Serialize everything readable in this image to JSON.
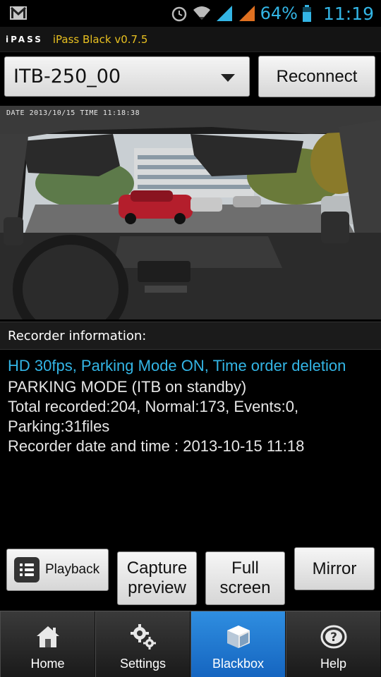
{
  "status_bar": {
    "battery_percent": "64%",
    "time": "11:19",
    "icons": [
      "gmail-icon",
      "alarm-icon",
      "wifi-icon",
      "signal-icon",
      "signal-orange-icon",
      "battery-icon"
    ]
  },
  "app": {
    "logo": "iPASS",
    "title": "iPass Black v0.7.5"
  },
  "device_select": {
    "value": "ITB-250_00"
  },
  "reconnect_label": "Reconnect",
  "video": {
    "osd_text": "DATE 2013/10/15  TIME 11:18:38"
  },
  "recorder": {
    "header": "Recorder information:",
    "status_line": "HD  30fps, Parking Mode ON, Time order deletion",
    "lines": [
      "PARKING MODE (ITB on standby)",
      "Total recorded:204, Normal:173, Events:0,",
      "Parking:31files",
      "Recorder date and time : 2013-10-15 11:18"
    ]
  },
  "actions": {
    "playback": "Playback",
    "capture_line1": "Capture",
    "capture_line2": "preview",
    "full_line1": "Full",
    "full_line2": "screen",
    "mirror": "Mirror"
  },
  "nav": {
    "items": [
      {
        "label": "Home",
        "icon": "home-icon"
      },
      {
        "label": "Settings",
        "icon": "gears-icon"
      },
      {
        "label": "Blackbox",
        "icon": "blackbox-icon"
      },
      {
        "label": "Help",
        "icon": "help-icon"
      }
    ],
    "active": "Blackbox"
  },
  "colors": {
    "accent": "#33b5e5",
    "title": "#e8c020",
    "nav_active": "#2f8ee0"
  }
}
